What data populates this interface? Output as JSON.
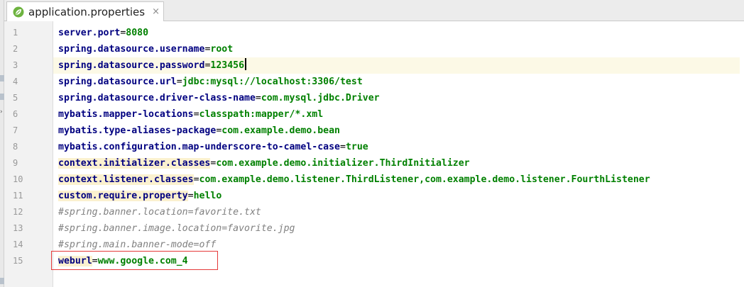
{
  "tab": {
    "title": "application.properties",
    "close_symbol": "×",
    "icon": "spring-leaf-icon",
    "icon_color": "#6db33f"
  },
  "editor": {
    "current_line": 3,
    "lines": [
      {
        "num": "1",
        "type": "prop",
        "key": "server.port",
        "eq": "=",
        "value": "8080"
      },
      {
        "num": "2",
        "type": "prop",
        "key": "spring.datasource.username",
        "eq": "=",
        "value": "root"
      },
      {
        "num": "3",
        "type": "prop",
        "key": "spring.datasource.password",
        "eq": "=",
        "value": "123456"
      },
      {
        "num": "4",
        "type": "prop",
        "key": "spring.datasource.url",
        "eq": "=",
        "value": "jdbc:mysql://localhost:3306/test"
      },
      {
        "num": "5",
        "type": "prop",
        "key": "spring.datasource.driver-class-name",
        "eq": "=",
        "value": "com.mysql.jdbc.Driver"
      },
      {
        "num": "6",
        "type": "prop",
        "key": "mybatis.mapper-locations",
        "eq": "=",
        "value": "classpath:mapper/*.xml"
      },
      {
        "num": "7",
        "type": "prop",
        "key": "mybatis.type-aliases-package",
        "eq": "=",
        "value": "com.example.demo.bean"
      },
      {
        "num": "8",
        "type": "prop",
        "key": "mybatis.configuration.map-underscore-to-camel-case",
        "eq": "=",
        "value": "true"
      },
      {
        "num": "9",
        "type": "prop",
        "key": "context.initializer.classes",
        "eq": "=",
        "value": "com.example.demo.initializer.ThirdInitializer"
      },
      {
        "num": "10",
        "type": "prop",
        "key": "context.listener.classes",
        "eq": "=",
        "value": "com.example.demo.listener.ThirdListener,com.example.demo.listener.FourthListener"
      },
      {
        "num": "11",
        "type": "prop",
        "key": "custom.require.property",
        "eq": "=",
        "value": "hello"
      },
      {
        "num": "12",
        "type": "comment",
        "text": "#spring.banner.location=favorite.txt"
      },
      {
        "num": "13",
        "type": "comment",
        "text": "#spring.banner.image.location=favorite.jpg"
      },
      {
        "num": "14",
        "type": "comment",
        "text": "#spring.main.banner-mode=off"
      },
      {
        "num": "15",
        "type": "prop",
        "key": "weburl",
        "eq": "=",
        "value": "www.google.com_4"
      }
    ]
  },
  "colors": {
    "key": "#000080",
    "value": "#008000",
    "comment": "#808080",
    "highlight_box": "#e53a3a"
  }
}
